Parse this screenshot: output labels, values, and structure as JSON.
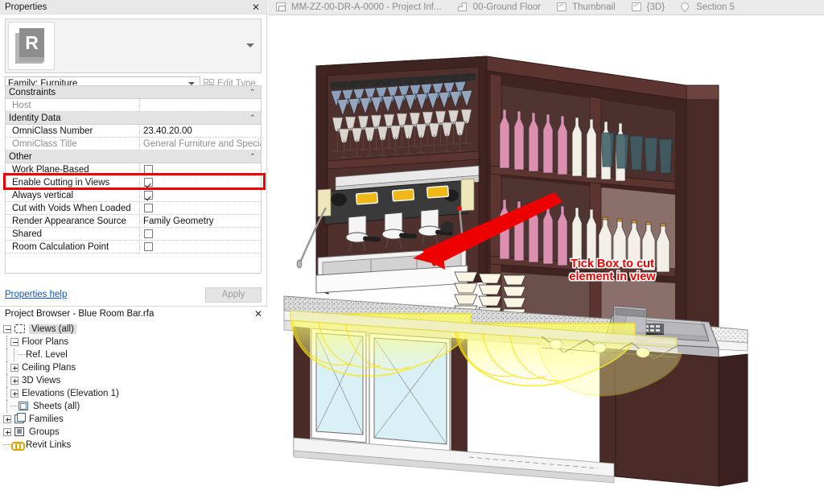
{
  "properties_palette": {
    "title": "Properties",
    "close_icon": "close-icon",
    "type_thumbnail_letter": "R",
    "family_selector_value": "Family: Furniture",
    "edit_type_label": "Edit Type",
    "help_link": "Properties help",
    "apply_label": "Apply",
    "groups": [
      {
        "name": "Constraints",
        "rows": [
          {
            "name": "Host",
            "type": "text",
            "value": "",
            "readonly": true
          }
        ]
      },
      {
        "name": "Identity Data",
        "rows": [
          {
            "name": "OmniClass Number",
            "type": "text",
            "value": "23.40.20.00",
            "readonly": false
          },
          {
            "name": "OmniClass Title",
            "type": "text",
            "value": "General Furniture and Specialties",
            "readonly": true
          }
        ]
      },
      {
        "name": "Other",
        "rows": [
          {
            "name": "Work Plane-Based",
            "type": "check",
            "checked": false,
            "readonly": false
          },
          {
            "name": "Enable Cutting in Views",
            "type": "check",
            "checked": true,
            "readonly": false,
            "highlighted": true
          },
          {
            "name": "Always vertical",
            "type": "check",
            "checked": true,
            "readonly": false
          },
          {
            "name": "Cut with Voids When Loaded",
            "type": "check",
            "checked": false,
            "readonly": false
          },
          {
            "name": "Render Appearance Source",
            "type": "text",
            "value": "Family Geometry",
            "readonly": false
          },
          {
            "name": "Shared",
            "type": "check",
            "checked": false,
            "readonly": false
          },
          {
            "name": "Room Calculation Point",
            "type": "check",
            "checked": false,
            "readonly": false
          }
        ]
      }
    ]
  },
  "project_browser": {
    "title": "Project Browser - Blue Room Bar.rfa",
    "close_icon": "close-icon",
    "nodes": [
      {
        "label": "Views (all)",
        "depth": 0,
        "state": "minus",
        "icon": "views-icon",
        "selected": true
      },
      {
        "label": "Floor Plans",
        "depth": 1,
        "state": "minus",
        "icon": "none",
        "selected": false
      },
      {
        "label": "Ref. Level",
        "depth": 2,
        "state": "leaf",
        "icon": "none",
        "selected": false
      },
      {
        "label": "Ceiling Plans",
        "depth": 1,
        "state": "plus",
        "icon": "none",
        "selected": false
      },
      {
        "label": "3D Views",
        "depth": 1,
        "state": "plus",
        "icon": "none",
        "selected": false
      },
      {
        "label": "Elevations (Elevation 1)",
        "depth": 1,
        "state": "plus",
        "icon": "none",
        "selected": false
      },
      {
        "label": "Sheets (all)",
        "depth": 1,
        "state": "leaf",
        "icon": "sheet-icon",
        "selected": false
      },
      {
        "label": "Families",
        "depth": 0,
        "state": "plus",
        "icon": "family-icon",
        "selected": false
      },
      {
        "label": "Groups",
        "depth": 0,
        "state": "plus",
        "icon": "group-icon",
        "selected": false
      },
      {
        "label": "Revit Links",
        "depth": 0,
        "state": "leaf",
        "icon": "link-icon",
        "selected": false
      }
    ]
  },
  "view_tabs": [
    {
      "label": "MM-ZZ-00-DR-A-0000 - Project Inf...",
      "icon": "sheet-icon"
    },
    {
      "label": "00-Ground Floor",
      "icon": "floor-plan-icon"
    },
    {
      "label": "Thumbnail",
      "icon": "3d-view-icon"
    },
    {
      "label": "{3D}",
      "icon": "3d-view-icon"
    },
    {
      "label": "Section 5",
      "icon": "section-icon"
    }
  ],
  "annotation": {
    "line1": "Tick Box to cut",
    "line2": "element in view",
    "color": "#ee0000",
    "arrow_color": "#ee0000",
    "highlight_color": "#ee0000"
  },
  "model_view": {
    "description": "3D isometric view of a bar counter unit",
    "colors": {
      "wood_dark": "#4a2b28",
      "wood_mid": "#5c3531",
      "wood_light": "#6d4340",
      "back_panel": "#8a6f6b",
      "counter_speckle": "#d9d9d9",
      "glass_door": "#d9f0f7",
      "light_glow": "#f2f24a",
      "bottle_pink": "#dd8fb0",
      "bottle_white": "#f3efe6",
      "glass_teal": "#3e5f66",
      "metal_grey": "#a8a8ad",
      "machine_dark": "#3a3a3a",
      "machine_yellow": "#f0b816"
    }
  }
}
